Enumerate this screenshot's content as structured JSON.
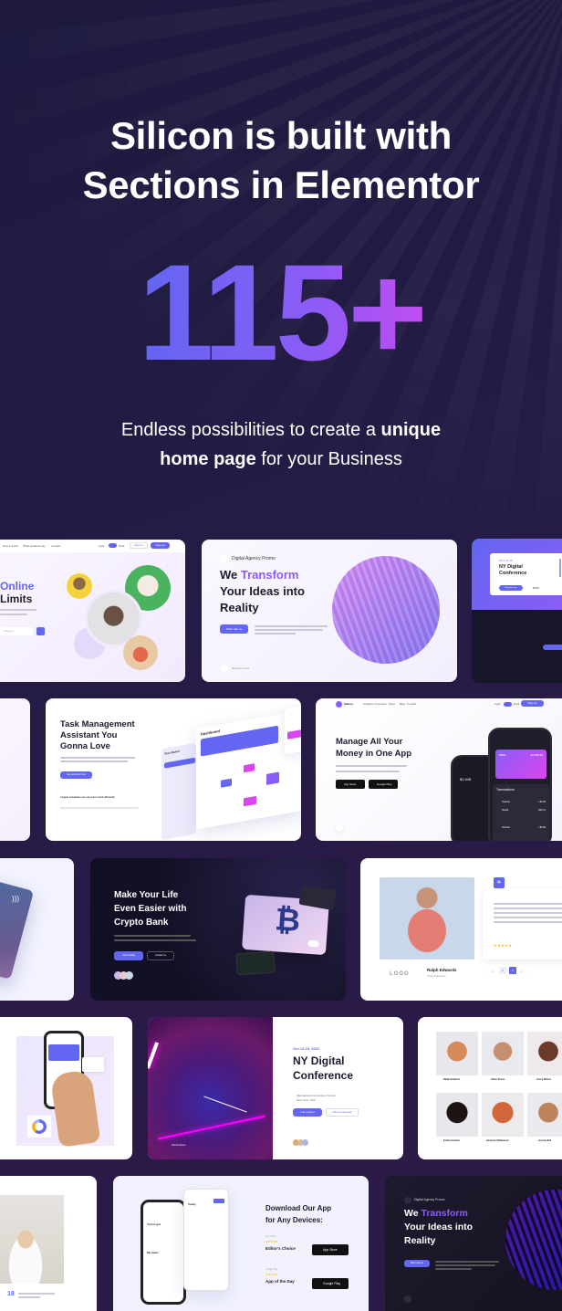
{
  "hero": {
    "headline_line1": "Silicon is built with",
    "headline_line2": "Sections in Elementor",
    "count": "115+",
    "sub_part1": "Endless possibilities to create a ",
    "sub_bold1": "unique",
    "sub_bold2": "home page",
    "sub_part2": " for your Business"
  },
  "colors": {
    "background": "#1f1b40",
    "accent": "#6366f1",
    "gradient_start": "#6366f1",
    "gradient_end": "#d946ef"
  },
  "previews": {
    "online_courses": {
      "nav": [
        "How it works",
        "What students say",
        "Contact"
      ],
      "theme_light": "Light",
      "theme_dark": "Dark",
      "sign_in": "Sign in",
      "sign_up": "Sign up",
      "title_accent": "Online",
      "title_rest": "Limits",
      "select_placeholder": "Category"
    },
    "agency_light": {
      "badge": "Digital Agency Promo",
      "title_plain": "We ",
      "title_accent": "Transform",
      "title_line2": "Your Ideas into",
      "title_line3": "Reality",
      "button": "Work with us",
      "scroll": "Discover more"
    },
    "conference_ticket": {
      "date": "OCT 14-15",
      "title_line1": "NY Digital",
      "title_line2": "Conference",
      "button": "Buy ticket now",
      "price": "$109"
    },
    "task_management": {
      "title_line1": "Task Management",
      "title_line2": "Assistant You",
      "title_line3": "Gonna Love",
      "button": "Get started for free",
      "trusted": "Largest companies use our tool to work efficiently",
      "dashboard_title": "Dashboard",
      "sidebar_title": "Task Master"
    },
    "finance_app": {
      "brand": "Silicon",
      "nav": [
        "Analytics",
        "Overview",
        "Store",
        "Blog",
        "Contact"
      ],
      "theme_light": "Light",
      "theme_dark": "Dark",
      "button": "Sign up",
      "title_line1": "Manage All Your",
      "title_line2": "Money in One App",
      "app_store": "App Store",
      "google_play": "Google Play",
      "card_brand": "VISA",
      "card_balance": "$4,299.50",
      "balance_small": "$1,945",
      "transactions": "Transactions",
      "tx": [
        {
          "name": "Transfer",
          "amount": "+ $4.99"
        },
        {
          "name": "Health",
          "amount": "- $29.11"
        },
        {
          "name": "Transfer",
          "amount": "+ $3.99"
        }
      ]
    },
    "crypto_bank": {
      "title_line1": "Make Your Life",
      "title_line2": "Even Easier with",
      "title_line3": "Crypto Bank",
      "button_primary": "Start trading",
      "button_secondary": "Contact us"
    },
    "testimonial": {
      "name": "Ralph Edwards",
      "role": "Head of Marketing",
      "logo": "LOGO",
      "pages": [
        "1",
        "2",
        "3",
        "4"
      ],
      "active_page": "3",
      "rating": 5
    },
    "ny_conference": {
      "date": "Oct 14-15, 2021",
      "title_line1": "NY Digital",
      "title_line2": "Conference",
      "location_line1": "International Convention Centre",
      "location_line2": "New York, USA",
      "button_primary": "Get a ticket",
      "button_secondary": "Add to calendar",
      "scroll": "Scroll down"
    },
    "team": {
      "members": [
        "Ralph Edwards",
        "Albert Flores",
        "Jenny Wilson",
        "Esther Howard",
        "Cameron Williamson",
        "Jerome Bell"
      ]
    },
    "download_app": {
      "title_line1": "Download Our App",
      "title_line2": "for Any Devices:",
      "store1_label": "App Store",
      "award1": "Editor's Choice",
      "store1_button": "App Store",
      "store2_label": "Google Play",
      "award2": "App of the Day",
      "store2_button": "Google Play",
      "phone_greeting": "You've got",
      "my_tasks": "My tasks",
      "today": "Today"
    },
    "agency_dark": {
      "badge": "Digital Agency Promo",
      "title_plain": "We ",
      "title_accent": "Transform",
      "title_line2": "Your Ideas into",
      "title_line3": "Reality",
      "button": "Work with us"
    },
    "podcast": {
      "stat": "18"
    }
  }
}
